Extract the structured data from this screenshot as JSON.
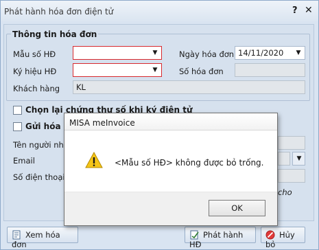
{
  "window": {
    "title": "Phát hành hóa đơn điện tử",
    "help": "?",
    "close": "✕"
  },
  "group": {
    "title": "Thông tin hóa đơn",
    "mau_so_label": "Mẫu số HĐ",
    "mau_so_value": "",
    "ky_hieu_label": "Ký hiệu HĐ",
    "ky_hieu_value": "",
    "khach_hang_label": "Khách hàng",
    "khach_hang_value": "KL",
    "ngay_label": "Ngày hóa đơn",
    "ngay_value": "14/11/2020",
    "so_label": "Số hóa đơn",
    "so_value": ""
  },
  "options": {
    "chon_lai_label": "Chọn lại chứng thư số khi ký điện tử",
    "gui_label": "Gửi hóa đơn",
    "ten_label": "Tên người nhận",
    "email_label": "Email",
    "sdt_label": "Số điện thoại",
    "tail_text": "cho"
  },
  "buttons": {
    "xem": "Xem hóa đơn",
    "phat_hanh": "Phát hành HĐ",
    "huy": "Hủy bỏ"
  },
  "msgbox": {
    "title": "MISA meInvoice",
    "message": "<Mẫu số HĐ> không được bỏ trống.",
    "ok": "OK"
  },
  "colors": {
    "error_border": "#d8282d",
    "accent": "#d9e4f1"
  }
}
